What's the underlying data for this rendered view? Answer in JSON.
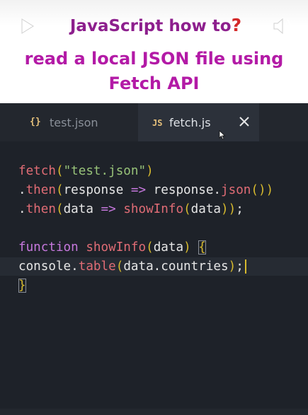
{
  "video_header": {
    "title_line1": "JavaScript how to",
    "title_line1_suffix": "?",
    "title_line2": "read a local JSON file using",
    "title_line3": "Fetch API",
    "play_icon": "play-icon",
    "volume_icon": "volume-icon",
    "colors": {
      "title_line1": "#8d1f8d",
      "title_lines_2_3": "#b31aa6",
      "question_mark": "#d42a2a"
    }
  },
  "editor": {
    "tabs": [
      {
        "icon_text": "{}",
        "label": "test.json",
        "active": false
      },
      {
        "icon_text": "JS",
        "label": "fetch.js",
        "active": true
      }
    ],
    "close_icon": "close-icon",
    "code_lines": [
      [
        {
          "t": "fetch",
          "c": "fn"
        },
        {
          "t": "(",
          "c": "paren"
        },
        {
          "t": "\"test.json\"",
          "c": "str"
        },
        {
          "t": ")",
          "c": "paren"
        }
      ],
      [
        {
          "t": ".",
          "c": "plain"
        },
        {
          "t": "then",
          "c": "fn"
        },
        {
          "t": "(",
          "c": "paren"
        },
        {
          "t": "response ",
          "c": "plain"
        },
        {
          "t": "=>",
          "c": "kw"
        },
        {
          "t": " response.",
          "c": "plain"
        },
        {
          "t": "json",
          "c": "fn"
        },
        {
          "t": "()",
          "c": "paren"
        },
        {
          "t": ")",
          "c": "paren"
        }
      ],
      [
        {
          "t": ".",
          "c": "plain"
        },
        {
          "t": "then",
          "c": "fn"
        },
        {
          "t": "(",
          "c": "paren"
        },
        {
          "t": "data ",
          "c": "plain"
        },
        {
          "t": "=>",
          "c": "kw"
        },
        {
          "t": " ",
          "c": "plain"
        },
        {
          "t": "showInfo",
          "c": "fn"
        },
        {
          "t": "(",
          "c": "paren"
        },
        {
          "t": "data",
          "c": "plain"
        },
        {
          "t": "))",
          "c": "paren"
        },
        {
          "t": ";",
          "c": "plain"
        }
      ],
      [],
      [
        {
          "t": "function",
          "c": "kw"
        },
        {
          "t": " ",
          "c": "plain"
        },
        {
          "t": "showInfo",
          "c": "fn"
        },
        {
          "t": "(",
          "c": "paren"
        },
        {
          "t": "data",
          "c": "plain"
        },
        {
          "t": ") ",
          "c": "paren"
        },
        {
          "t": "{",
          "c": "brace-hl"
        }
      ],
      [
        {
          "t": "console.",
          "c": "plain"
        },
        {
          "t": "table",
          "c": "fn"
        },
        {
          "t": "(",
          "c": "paren"
        },
        {
          "t": "data.countries",
          "c": "plain"
        },
        {
          "t": ")",
          "c": "paren"
        },
        {
          "t": ";",
          "c": "plain"
        },
        {
          "t": "",
          "c": "caret"
        }
      ],
      [
        {
          "t": "}",
          "c": "brace-hl"
        }
      ]
    ],
    "active_line_index": 5,
    "colors": {
      "function_name": "#e06c75",
      "string": "#98c379",
      "keyword": "#c678dd",
      "paren": "#d7ba2e",
      "plain": "#e6e6e6"
    }
  }
}
